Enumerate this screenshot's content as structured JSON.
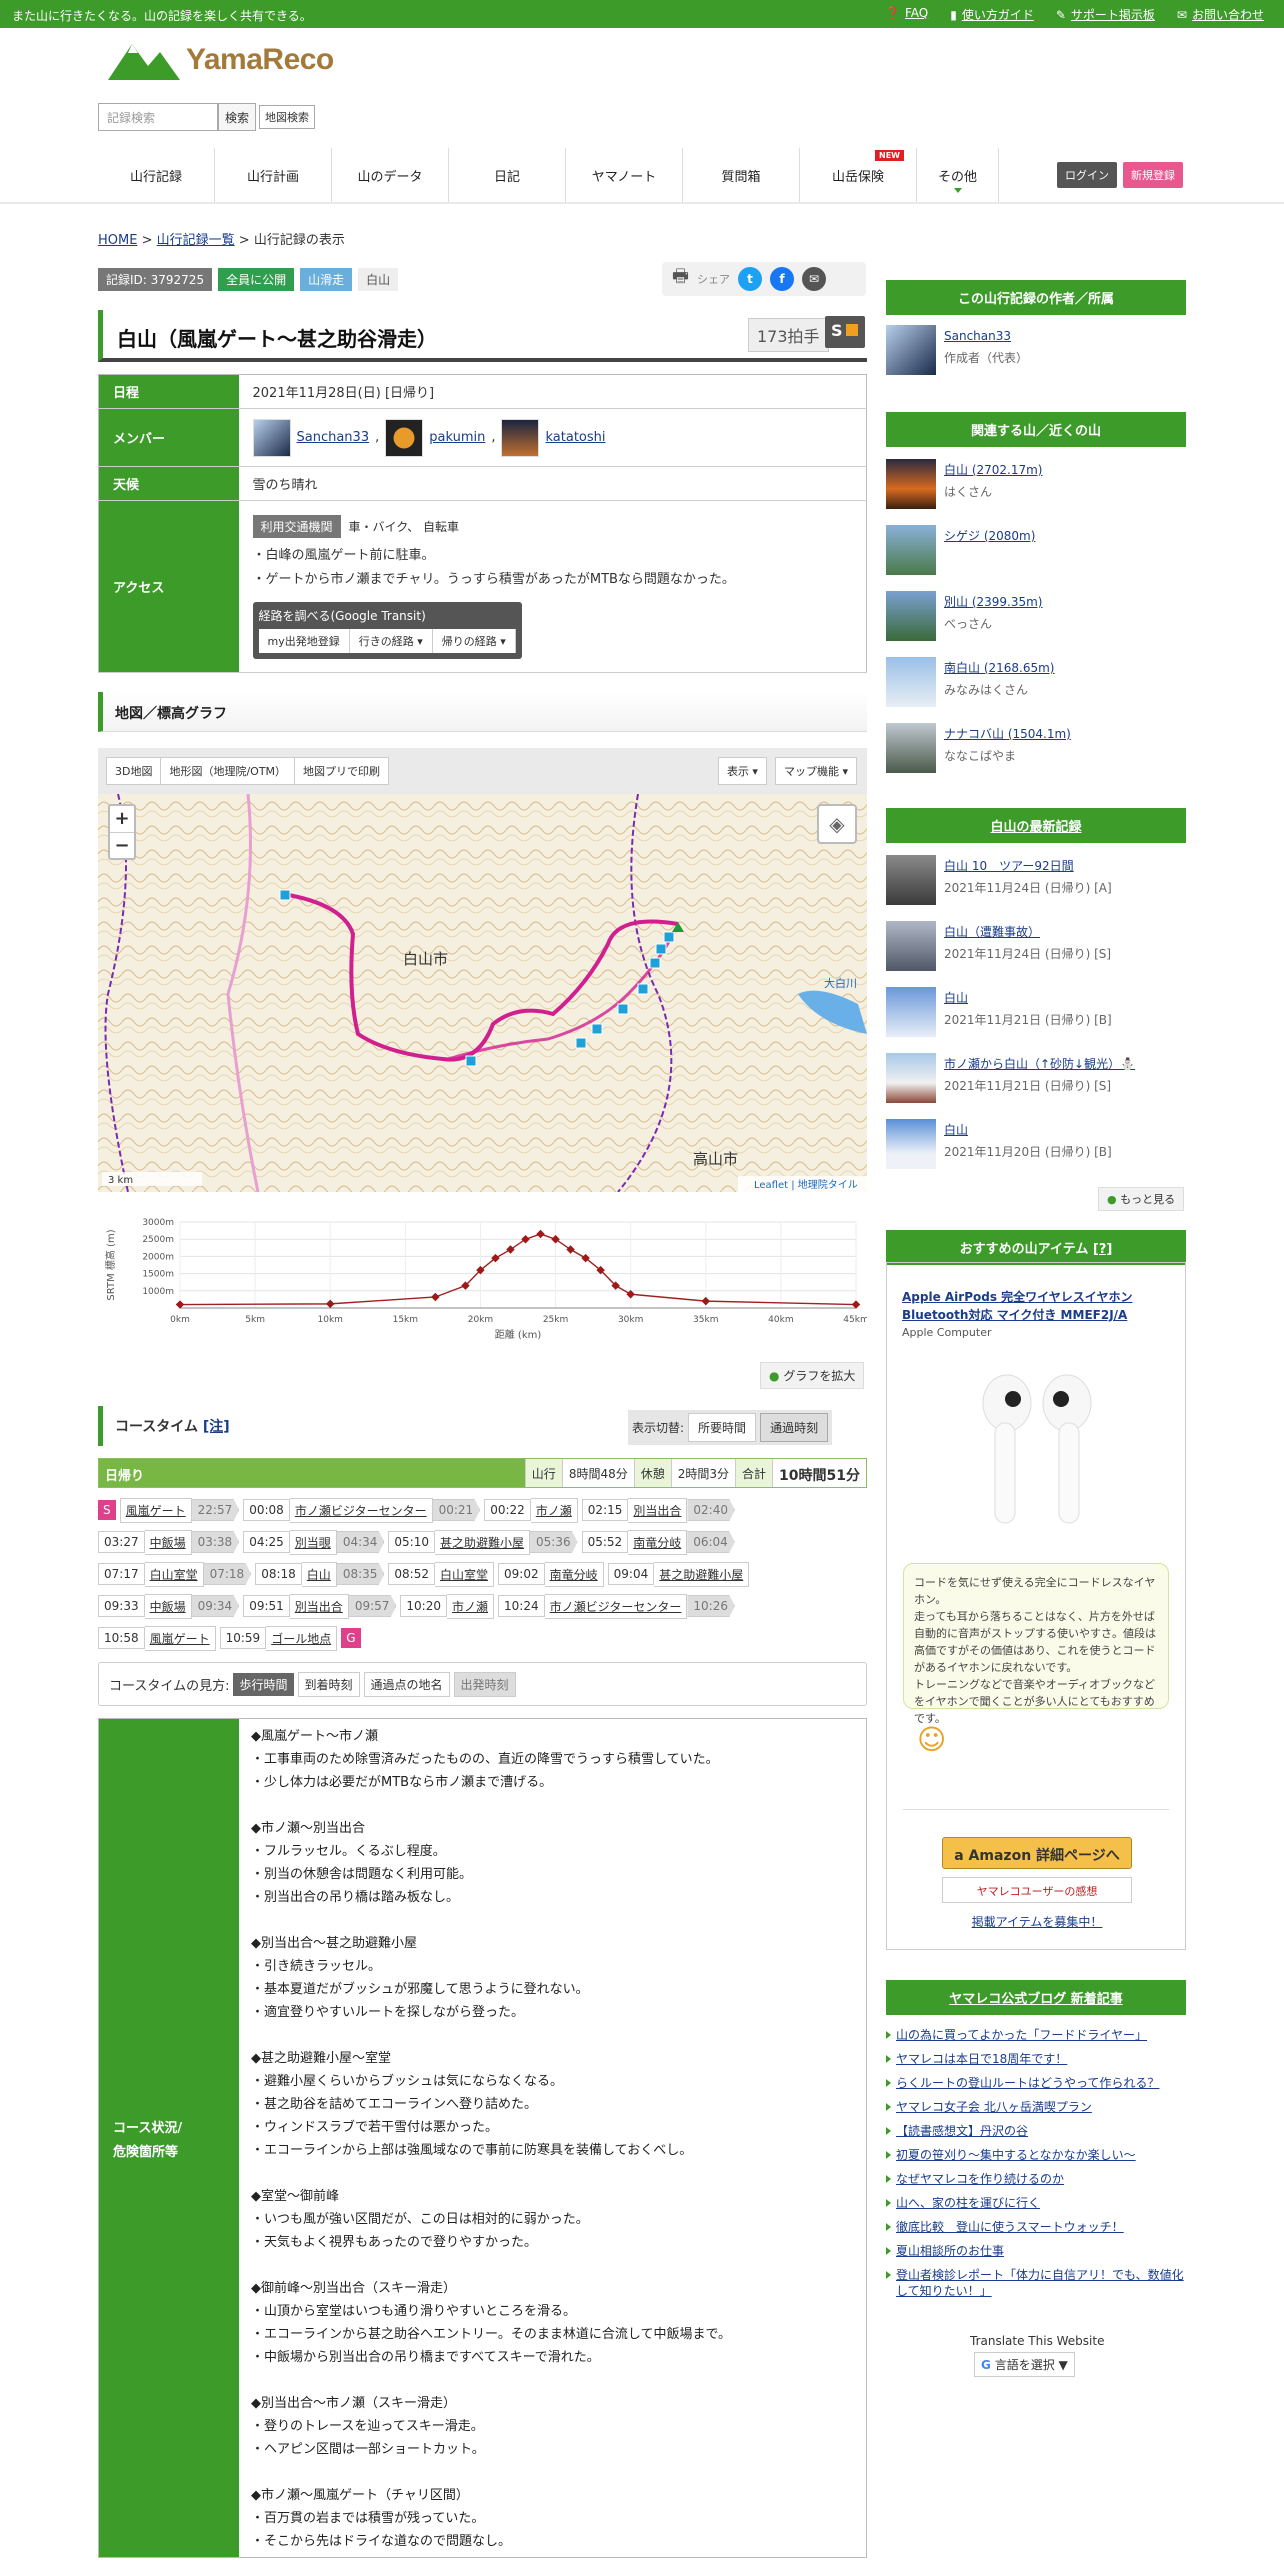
{
  "topbar": {
    "message": "また山に行きたくなる。山の記録を楽しく共有できる。",
    "links": [
      "FAQ",
      "使い方ガイド",
      "サポート掲示板",
      "お問い合わせ"
    ]
  },
  "logo": {
    "name": "YamaReco"
  },
  "search": {
    "placeholder": "記録検索",
    "search_label": "検索",
    "map_search_label": "地図検索"
  },
  "nav": {
    "items": [
      "山行記録",
      "山行計画",
      "山のデータ",
      "日記",
      "ヤマノート",
      "質問箱",
      "山岳保険",
      "その他"
    ],
    "new_badge": "NEW",
    "login": "ログイン",
    "signup": "新規登録"
  },
  "breadcrumb": {
    "home": "HOME",
    "list": "山行記録一覧",
    "current": "山行記録の表示",
    "sep": ">"
  },
  "tags": [
    "記録ID: 3792725",
    "全員に公開",
    "山滑走",
    "白山"
  ],
  "share": {
    "label": "シェア"
  },
  "record": {
    "title": "白山（風嵐ゲート～甚之助谷滑走）",
    "likes": "173拍手",
    "grade": "S"
  },
  "info": {
    "date_label": "日程",
    "date": "2021年11月28日(日) [日帰り]",
    "member_label": "メンバー",
    "members": [
      "Sanchan33",
      "pakumin",
      "katatoshi"
    ],
    "weather_label": "天候",
    "weather": "雪のち晴れ",
    "access_label": "アクセス",
    "transport_chip": "利用交通機関",
    "transport": "車・バイク、 自転車",
    "access_lines": [
      "・白峰の風嵐ゲート前に駐車。",
      "・ゲートから市ノ瀬までチャリ。うっすら積雪があったがMTBなら問題なかった。"
    ],
    "route_title": "経路を調べる(Google Transit)",
    "route_buttons": [
      "my出発地登録",
      "行きの経路 ▾",
      "帰りの経路 ▾"
    ]
  },
  "map_section": {
    "title": "地図／標高グラフ",
    "buttons": [
      "3D地図",
      "地形図（地理院/OTM）",
      "地図プリで印刷"
    ],
    "right_buttons": [
      "表示 ▾",
      "マップ機能 ▾"
    ],
    "labels": [
      "白山市",
      "高山市",
      "大白川"
    ],
    "scale": "3 km",
    "attribution": "Leaflet | 地理院タイル"
  },
  "chart_data": {
    "type": "line",
    "xlabel": "距離 (km)",
    "ylabel": "SRTM 標高 (m)",
    "x_ticks": [
      "0km",
      "5km",
      "10km",
      "15km",
      "20km",
      "25km",
      "30km",
      "35km",
      "40km",
      "45km"
    ],
    "y_ticks": [
      "1000m",
      "1500m",
      "2000m",
      "2500m",
      "3000m"
    ],
    "xlim": [
      0,
      45
    ],
    "ylim": [
      500,
      3000
    ],
    "x": [
      0,
      10,
      17,
      19,
      20,
      21,
      22,
      23,
      24,
      25,
      26,
      27,
      28,
      29,
      30,
      35,
      45
    ],
    "y": [
      600,
      620,
      820,
      1150,
      1600,
      1950,
      2200,
      2500,
      2650,
      2500,
      2200,
      1950,
      1600,
      1150,
      900,
      700,
      600
    ],
    "grid": true
  },
  "graph_button": "グラフを拡大",
  "course": {
    "title": "コースタイム",
    "note": "[注]",
    "toggle_label": "表示切替:",
    "toggle_options": [
      "所要時間",
      "通過時刻"
    ],
    "day": "日帰り",
    "stats": [
      {
        "k": "山行",
        "v": "8時間48分"
      },
      {
        "k": "休憩",
        "v": "2時間3分"
      },
      {
        "k": "合計",
        "v": "10時間51分"
      }
    ],
    "rows": [
      [
        {
          "s": "S"
        },
        {
          "p": "風嵐ゲート",
          "t2": "22:57"
        },
        {
          "t": "00:08",
          "p": "市ノ瀬ビジターセンター",
          "t2": "00:21"
        },
        {
          "t": "00:22",
          "p": "市ノ瀬"
        },
        {
          "t": "02:15",
          "p": "別当出合",
          "t2": "02:40"
        }
      ],
      [
        {
          "t": "03:27",
          "p": "中飯場",
          "t2": "03:38"
        },
        {
          "t": "04:25",
          "p": "別当覗",
          "t2": "04:34"
        },
        {
          "t": "05:10",
          "p": "甚之助避難小屋",
          "t2": "05:36"
        },
        {
          "t": "05:52",
          "p": "南竜分岐",
          "t2": "06:04"
        }
      ],
      [
        {
          "t": "07:17",
          "p": "白山室堂",
          "t2": "07:18"
        },
        {
          "t": "08:18",
          "p": "白山",
          "t2": "08:35"
        },
        {
          "t": "08:52",
          "p": "白山室堂"
        },
        {
          "t": "09:02",
          "p": "南竜分岐"
        },
        {
          "t": "09:04",
          "p": "甚之助避難小屋"
        }
      ],
      [
        {
          "t": "09:33",
          "p": "中飯場",
          "t2": "09:34"
        },
        {
          "t": "09:51",
          "p": "別当出合",
          "t2": "09:57"
        },
        {
          "t": "10:20",
          "p": "市ノ瀬"
        },
        {
          "t": "10:24",
          "p": "市ノ瀬ビジターセンター",
          "t2": "10:26"
        }
      ],
      [
        {
          "t": "10:58",
          "p": "風嵐ゲート"
        },
        {
          "t": "10:59",
          "p": "ゴール地点"
        },
        {
          "g": "G"
        }
      ]
    ],
    "legend": {
      "label": "コースタイムの見方:",
      "items": [
        "歩行時間",
        "到着時刻",
        "通過点の地名",
        "出発時刻"
      ]
    }
  },
  "condition": {
    "label": "コース状況/\n危険箇所等",
    "text": "◆風嵐ゲート～市ノ瀬\n・工事車両のため除雪済みだったものの、直近の降雪でうっすら積雪していた。\n・少し体力は必要だがMTBなら市ノ瀬まで漕げる。\n\n◆市ノ瀬～別当出合\n・フルラッセル。くるぶし程度。\n・別当の休憩舎は問題なく利用可能。\n・別当出合の吊り橋は踏み板なし。\n\n◆別当出合～甚之助避難小屋\n・引き続きラッセル。\n・基本夏道だがブッシュが邪魔して思うように登れない。\n・適宜登りやすいルートを探しながら登った。\n\n◆甚之助避難小屋～室堂\n・避難小屋くらいからブッシュは気にならなくなる。\n・甚之助谷を詰めてエコーラインへ登り詰めた。\n・ウィンドスラブで若干雪付は悪かった。\n・エコーラインから上部は強風域なので事前に防寒具を装備しておくべし。\n\n◆室堂～御前峰\n・いつも風が強い区間だが、この日は相対的に弱かった。\n・天気もよく視界もあったので登りやすかった。\n\n◆御前峰～別当出合（スキー滑走）\n・山頂から室堂はいつも通り滑りやすいところを滑る。\n・エコーラインから甚之助谷へエントリー。そのまま林道に合流して中飯場まで。\n・中飯場から別当出合の吊り橋まですべてスキーで滑れた。\n\n◆別当出合～市ノ瀬（スキー滑走）\n・登りのトレースを辿ってスキー滑走。\n・ヘアピン区間は一部ショートカット。\n\n◆市ノ瀬～風嵐ゲート（チャリ区間）\n・百万貫の岩までは積雪が残っていた。\n・そこから先はドライな道なので問題なし。"
  },
  "sidebar": {
    "author_title": "この山行記録の作者／所属",
    "author": {
      "name": "Sanchan33",
      "role": "作成者（代表）"
    },
    "related_title": "関連する山／近くの山",
    "related": [
      {
        "name": "白山 (2702.17m)",
        "kana": "はくさん"
      },
      {
        "name": "シゲジ (2080m)",
        "kana": ""
      },
      {
        "name": "別山 (2399.35m)",
        "kana": "べっさん"
      },
      {
        "name": "南白山 (2168.65m)",
        "kana": "みなみはくさん"
      },
      {
        "name": "ナナコバ山 (1504.1m)",
        "kana": "ななこばやま"
      }
    ],
    "latest_title": "白山の最新記録",
    "latest": [
      {
        "name": "白山 10　ツアー92日間",
        "date": "2021年11月24日 (日帰り) [A]"
      },
      {
        "name": "白山（遭難事故）",
        "date": "2021年11月24日 (日帰り) [S]"
      },
      {
        "name": "白山",
        "date": "2021年11月21日 (日帰り) [B]"
      },
      {
        "name": "市ノ瀬から白山（↑砂防↓観光）⛄",
        "date": "2021年11月21日 (日帰り) [S]"
      },
      {
        "name": "白山",
        "date": "2021年11月20日 (日帰り) [B]"
      }
    ],
    "more": "もっと見る",
    "item_title": "おすすめの山アイテム",
    "item_help": "[?]",
    "product": {
      "name": "Apple AirPods 完全ワイヤレスイヤホン Bluetooth対応 マイク付き MMEF2J/A",
      "maker": "Apple Computer",
      "review": "コードを気にせず使える完全にコードレスなイヤホン。\n走っても耳から落ちることはなく、片方を外せば自動的に音声がストップする使いやすさ。値段は高価ですがその価値はあり、これを使うとコードがあるイヤホンに戻れないです。\nトレーニングなどで音楽やオーディオブックなどをイヤホンで聞くことが多い人にとてもおすすめです。",
      "amazon": "a Amazon 詳細ページへ",
      "impression": "ヤマレコユーザーの感想",
      "recruit": "掲載アイテムを募集中！"
    },
    "blog_title": "ヤマレコ公式ブログ 新着記事",
    "blog": [
      "山の為に買ってよかった「フードドライヤー」",
      "ヤマレコは本日で18周年です！",
      "らくルートの登山ルートはどうやって作られる？",
      "ヤマレコ女子会 北八ヶ岳満喫プラン",
      "【読書感想文】丹沢の谷",
      "初夏の笹刈り～集中するとなかなか楽しい～",
      "なぜヤマレコを作り続けるのか",
      "山へ、家の柱を運びに行く",
      "徹底比較　登山に使うスマートウォッチ！",
      "夏山相談所のお仕事",
      "登山者検診レポート「体力に自信アリ！でも、数値化して知りたい！」"
    ],
    "translate": "Translate This Website",
    "lang": "言語を選択 ▼"
  },
  "colors": {
    "green": "#3d9b2a",
    "pink": "#e0408a",
    "route": "#d21f8f"
  }
}
